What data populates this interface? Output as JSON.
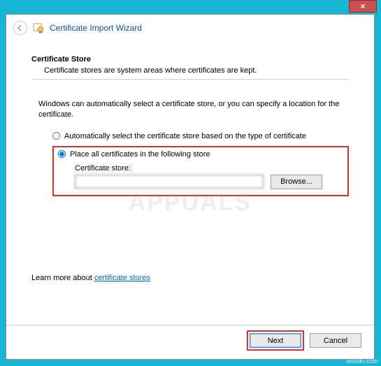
{
  "titlebar": {
    "close": "×"
  },
  "header": {
    "title": "Certificate Import Wizard"
  },
  "section": {
    "title": "Certificate Store",
    "desc": "Certificate stores are system areas where certificates are kept."
  },
  "body": {
    "intro": "Windows can automatically select a certificate store, or you can specify a location for the certificate."
  },
  "radios": {
    "auto": "Automatically select the certificate store based on the type of certificate",
    "place": "Place all certificates in the following store"
  },
  "store": {
    "label": "Certificate store:",
    "value": "",
    "browse": "Browse..."
  },
  "learn": {
    "prefix": "Learn more about ",
    "link": "certificate stores"
  },
  "footer": {
    "next": "Next",
    "cancel": "Cancel"
  },
  "watermark": "APPUALS",
  "domain_text": "wsxdn.com"
}
